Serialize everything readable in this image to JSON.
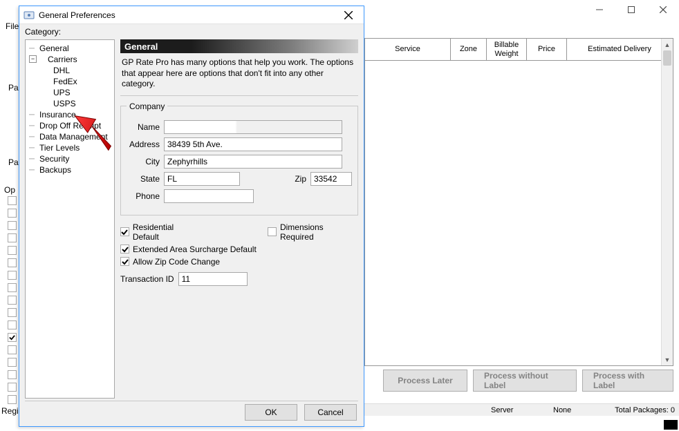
{
  "main_window": {
    "menubar": {
      "file": "File"
    },
    "side_labels": {
      "p1": "Pa",
      "p2": "Pa",
      "opt": "Op",
      "regi": "Regi"
    },
    "checkboxes_checked": [
      false,
      false,
      false,
      false,
      false,
      false,
      false,
      false,
      false,
      false,
      false,
      true,
      false,
      false,
      false,
      false,
      false
    ],
    "table_headers": {
      "service": "Service",
      "zone": "Zone",
      "billable_weight": "Billable Weight",
      "price": "Price",
      "estimated_delivery": "Estimated Delivery"
    },
    "buttons": {
      "process_later": "Process Later",
      "process_without_label": "Process without Label",
      "process_with_label": "Process with Label"
    },
    "status": {
      "server_label": "Server",
      "server_value": "None",
      "total_packages_label": "Total Packages:",
      "total_packages_value": "0"
    }
  },
  "dialog": {
    "title": "General Preferences",
    "category_label": "Category:",
    "tree": {
      "general": "General",
      "carriers": {
        "label": "Carriers",
        "children": [
          "DHL",
          "FedEx",
          "UPS",
          "USPS"
        ]
      },
      "insurance": "Insurance",
      "drop_off_receipt": "Drop Off Receipt",
      "data_management": "Data Management",
      "tier_levels": "Tier Levels",
      "security": "Security",
      "backups": "Backups"
    },
    "header": "General",
    "description": "GP Rate Pro has many options that help you work. The options that appear here are options that don't fit into any other category.",
    "company_legend": "Company",
    "fields": {
      "name": {
        "label": "Name",
        "value": ""
      },
      "address": {
        "label": "Address",
        "value": "38439 5th Ave."
      },
      "city": {
        "label": "City",
        "value": "Zephyrhills"
      },
      "state": {
        "label": "State",
        "value": "FL"
      },
      "zip": {
        "label": "Zip",
        "value": "33542"
      },
      "phone": {
        "label": "Phone",
        "value": ""
      }
    },
    "checkboxes": {
      "residential_default": {
        "label": "Residential Default",
        "checked": true
      },
      "dimensions_required": {
        "label": "Dimensions Required",
        "checked": false
      },
      "extended_area": {
        "label": "Extended Area Surcharge Default",
        "checked": true
      },
      "allow_zip": {
        "label": "Allow Zip Code Change",
        "checked": true
      }
    },
    "transaction_id": {
      "label": "Transaction ID",
      "value": "11"
    },
    "buttons": {
      "ok": "OK",
      "cancel": "Cancel"
    }
  }
}
